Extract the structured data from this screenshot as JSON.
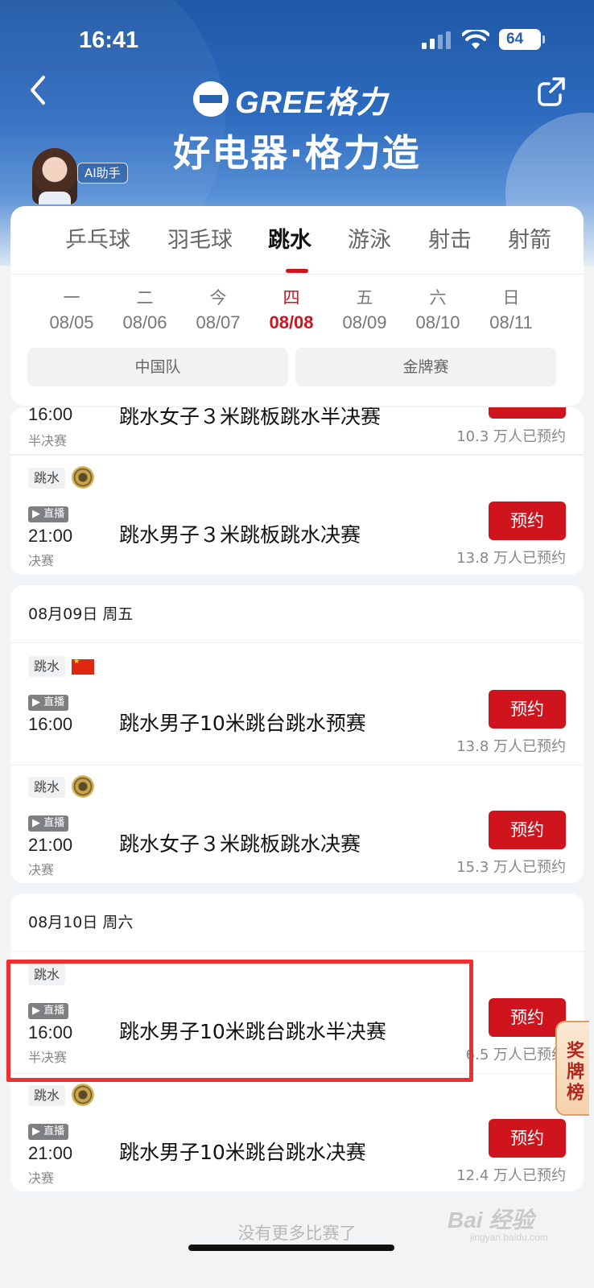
{
  "status": {
    "time": "16:41",
    "battery": "64"
  },
  "header": {
    "brand": "GREE格力",
    "slogan": "好电器·格力造",
    "ai_label": "AI助手"
  },
  "sport_tabs": [
    {
      "label": "乒乓球"
    },
    {
      "label": "羽毛球"
    },
    {
      "label": "跳水"
    },
    {
      "label": "游泳"
    },
    {
      "label": "射击"
    },
    {
      "label": "射箭"
    }
  ],
  "active_tab": "跳水",
  "dates": [
    {
      "weekday": "一",
      "date": "08/05"
    },
    {
      "weekday": "二",
      "date": "08/06"
    },
    {
      "weekday": "今",
      "date": "08/07"
    },
    {
      "weekday": "四",
      "date": "08/08"
    },
    {
      "weekday": "五",
      "date": "08/09"
    },
    {
      "weekday": "六",
      "date": "08/10"
    },
    {
      "weekday": "日",
      "date": "08/11"
    }
  ],
  "active_date": "08/08",
  "filters": {
    "china_team": "中国队",
    "gold_medal": "金牌赛"
  },
  "partial_event": {
    "time": "16:00",
    "stage": "半决赛",
    "title": "跳水女子３米跳板跳水半决赛",
    "count": "10.3 万人已预约"
  },
  "card1": {
    "events": [
      {
        "tag": "跳水",
        "live": "▶ 直播",
        "time": "21:00",
        "stage": "决赛",
        "title": "跳水男子３米跳板跳水决赛",
        "button": "预约",
        "count": "13.8 万人已预约"
      }
    ]
  },
  "card2": {
    "header": "08月09日 周五",
    "events": [
      {
        "tag": "跳水",
        "live": "▶ 直播",
        "time": "16:00",
        "stage": "",
        "title": "跳水男子10米跳台跳水预赛",
        "button": "预约",
        "count": "13.8 万人已预约"
      },
      {
        "tag": "跳水",
        "live": "▶ 直播",
        "time": "21:00",
        "stage": "决赛",
        "title": "跳水女子３米跳板跳水决赛",
        "button": "预约",
        "count": "15.3 万人已预约"
      }
    ]
  },
  "card3": {
    "header": "08月10日 周六",
    "events": [
      {
        "tag": "跳水",
        "live": "▶ 直播",
        "time": "16:00",
        "stage": "半决赛",
        "title": "跳水男子10米跳台跳水半决赛",
        "button": "预约",
        "count": "6.5 万人已预约"
      },
      {
        "tag": "跳水",
        "live": "▶ 直播",
        "time": "21:00",
        "stage": "决赛",
        "title": "跳水男子10米跳台跳水决赛",
        "button": "预约",
        "count": "12.4 万人已预约"
      }
    ]
  },
  "medal_board": "奖牌榜",
  "footer": {
    "no_more": "没有更多比赛了"
  },
  "watermark": {
    "main": "Bai 经验",
    "sub": "jingyan.baidu.com"
  },
  "colors": {
    "accent": "#d0141e",
    "banner": "#1f58a6",
    "highlight": "#ee2f2f"
  }
}
